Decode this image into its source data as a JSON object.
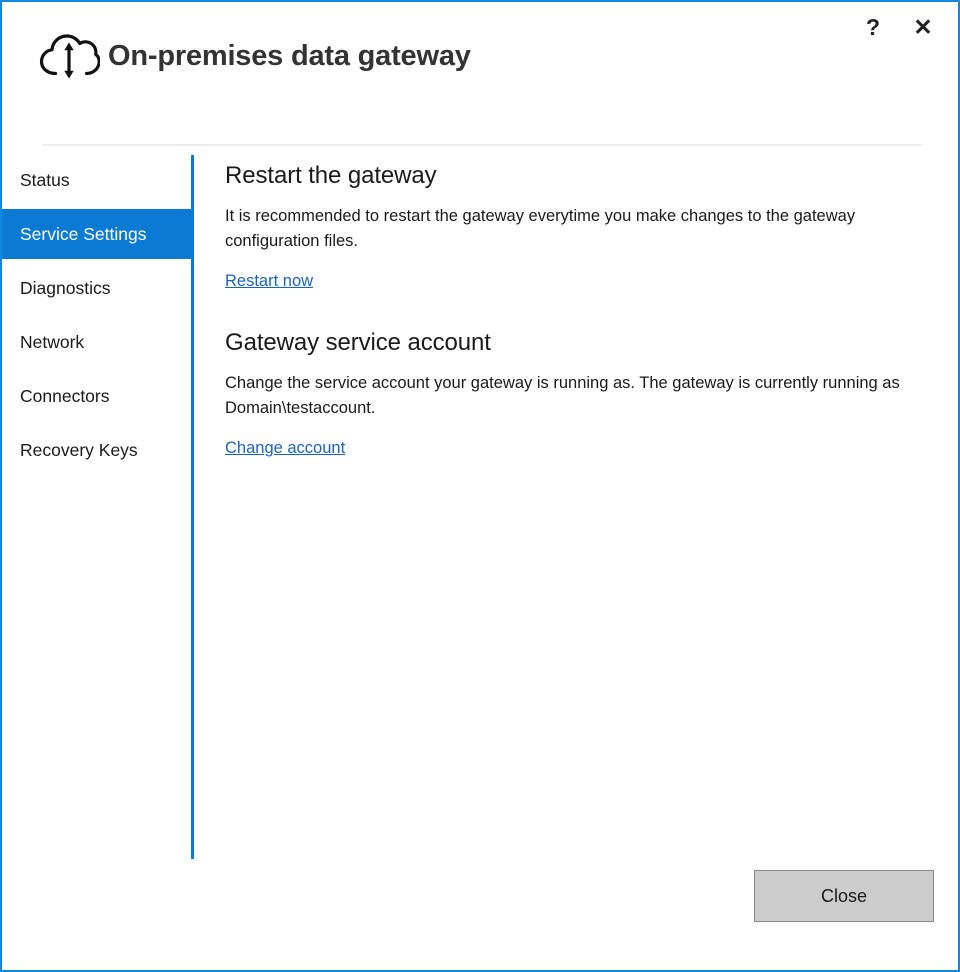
{
  "window": {
    "title": "On-premises data gateway",
    "icon": "cloud-sync-icon",
    "border_color": "#1188dd",
    "accent_color": "#0b7ad4",
    "link_color": "#1b62c4"
  },
  "titlebar": {
    "help_label": "?",
    "close_label": "✕"
  },
  "sidebar": {
    "items": [
      {
        "label": "Status",
        "selected": false
      },
      {
        "label": "Service Settings",
        "selected": true
      },
      {
        "label": "Diagnostics",
        "selected": false
      },
      {
        "label": "Network",
        "selected": false
      },
      {
        "label": "Connectors",
        "selected": false
      },
      {
        "label": "Recovery Keys",
        "selected": false
      }
    ]
  },
  "main": {
    "sections": [
      {
        "heading": "Restart the gateway",
        "text": "It is recommended to restart the gateway everytime you make changes to the gateway configuration files.",
        "link": "Restart now"
      },
      {
        "heading": "Gateway service account",
        "text": "Change the service account your gateway is running as. The gateway is currently running as Domain\\testaccount.",
        "link": "Change account"
      }
    ]
  },
  "footer": {
    "close_label": "Close"
  }
}
